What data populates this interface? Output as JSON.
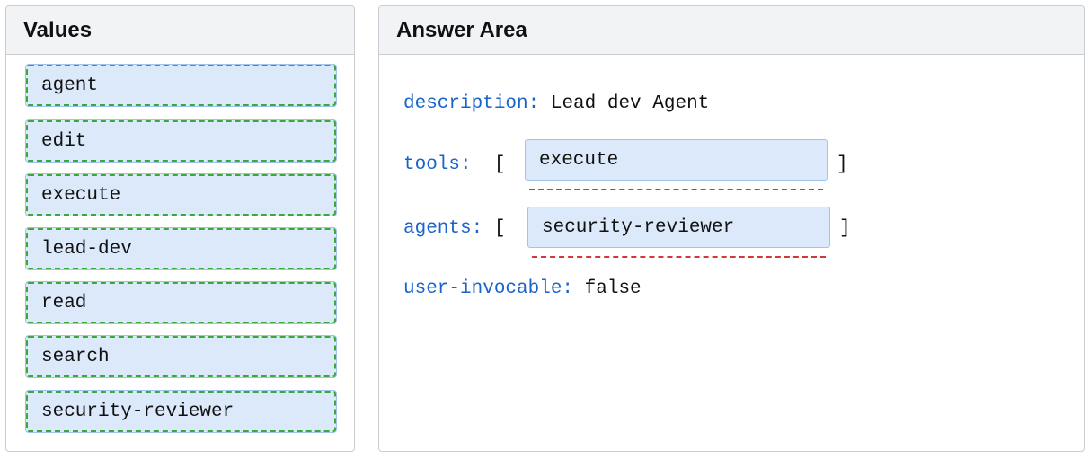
{
  "values_panel": {
    "title": "Values",
    "items": [
      {
        "label": "agent"
      },
      {
        "label": "edit"
      },
      {
        "label": "execute"
      },
      {
        "label": "lead-dev"
      },
      {
        "label": "read"
      },
      {
        "label": "search"
      },
      {
        "label": "security-reviewer"
      }
    ]
  },
  "answer_panel": {
    "title": "Answer Area",
    "description": {
      "key": "description:",
      "value": "Lead dev Agent"
    },
    "tools": {
      "key": "tools:",
      "open": "[",
      "slot_value": "execute",
      "close": "]"
    },
    "agents": {
      "key": "agents:",
      "open": "[",
      "slot_value": "security-reviewer",
      "close": "]"
    },
    "user_invocable": {
      "key": "user-invocable:",
      "value": "false"
    }
  },
  "colors": {
    "key_blue": "#1a64c9",
    "item_fill": "#dce9fb",
    "item_border_dashed": "#3aa83a",
    "slot_underline": "#d13838"
  }
}
